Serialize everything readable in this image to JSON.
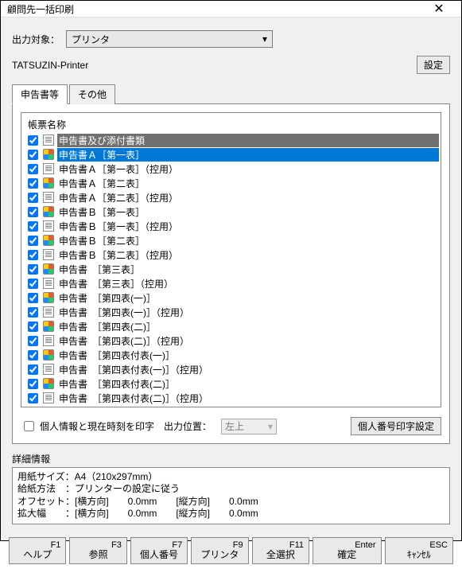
{
  "window": {
    "title": "顧問先一括印刷"
  },
  "output": {
    "label": "出力対象：",
    "select_value": "プリンタ",
    "printer_name": "TATSUZIN-Printer",
    "settings_btn": "設定"
  },
  "tabs": {
    "t0": "申告書等",
    "t1": "その他"
  },
  "list": {
    "header": "帳票名称",
    "items": [
      {
        "checked": true,
        "ico": "doc",
        "label": "申告書及び添付書類",
        "style": "hdr"
      },
      {
        "checked": true,
        "ico": "color",
        "label": "申告書Ａ［第一表］",
        "style": "sel"
      },
      {
        "checked": true,
        "ico": "doc",
        "label": "申告書Ａ［第一表］（控用）"
      },
      {
        "checked": true,
        "ico": "color",
        "label": "申告書Ａ［第二表］"
      },
      {
        "checked": true,
        "ico": "doc",
        "label": "申告書Ａ［第二表］（控用）"
      },
      {
        "checked": true,
        "ico": "color",
        "label": "申告書Ｂ［第一表］"
      },
      {
        "checked": true,
        "ico": "doc",
        "label": "申告書Ｂ［第一表］（控用）"
      },
      {
        "checked": true,
        "ico": "color",
        "label": "申告書Ｂ［第二表］"
      },
      {
        "checked": true,
        "ico": "doc",
        "label": "申告書Ｂ［第二表］（控用）"
      },
      {
        "checked": true,
        "ico": "color",
        "label": "申告書　［第三表］"
      },
      {
        "checked": true,
        "ico": "doc",
        "label": "申告書　［第三表］（控用）"
      },
      {
        "checked": true,
        "ico": "color",
        "label": "申告書　［第四表(一)］"
      },
      {
        "checked": true,
        "ico": "doc",
        "label": "申告書　［第四表(一)］（控用）"
      },
      {
        "checked": true,
        "ico": "color",
        "label": "申告書　［第四表(二)］"
      },
      {
        "checked": true,
        "ico": "doc",
        "label": "申告書　［第四表(二)］（控用）"
      },
      {
        "checked": true,
        "ico": "color",
        "label": "申告書　［第四表付表(一)］"
      },
      {
        "checked": true,
        "ico": "doc",
        "label": "申告書　［第四表付表(一)］（控用）"
      },
      {
        "checked": true,
        "ico": "color",
        "label": "申告書　［第四表付表(二)］"
      },
      {
        "checked": true,
        "ico": "doc",
        "label": "申告書　［第四表付表(二)］（控用）"
      }
    ]
  },
  "opts": {
    "chk_personal": "個人情報と現在時刻を印字",
    "poslabel": "出力位置：",
    "posval": "左上",
    "numset_btn": "個人番号印字設定"
  },
  "detail": {
    "header": "詳細情報",
    "l1": "用紙サイズ：A4（210x297mm）",
    "l2": "給紙方法　：プリンターの設定に従う",
    "l3": "オフセット：[横方向]　　0.0mm　　[縦方向]　　0.0mm",
    "l4": "拡大幅　　：[横方向]　　0.0mm　　[縦方向]　　0.0mm"
  },
  "fkeys": {
    "f1k": "F1",
    "f1l": "ヘルプ",
    "f3k": "F3",
    "f3l": "参照",
    "f7k": "F7",
    "f7l": "個人番号",
    "f9k": "F9",
    "f9l": "プリンタ",
    "f11k": "F11",
    "f11l": "全選択",
    "ek": "Enter",
    "el": "確定",
    "esck": "ESC",
    "escl": "ｷｬﾝｾﾙ"
  }
}
